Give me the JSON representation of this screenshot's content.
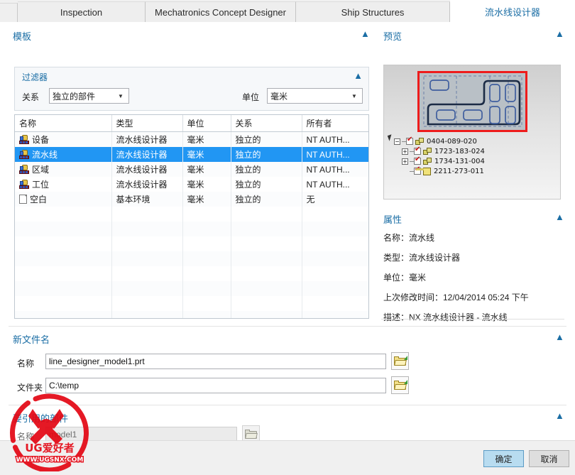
{
  "tabs": [
    {
      "label": "Inspection",
      "active": false
    },
    {
      "label": "Mechatronics Concept Designer",
      "active": false
    },
    {
      "label": "Ship Structures",
      "active": false
    },
    {
      "label": "流水线设计器",
      "active": true
    }
  ],
  "sections": {
    "template": {
      "title": "模板",
      "collapse_icon": "chevron-up-icon"
    },
    "preview": {
      "title": "预览",
      "collapse_icon": "chevron-up-icon"
    },
    "properties": {
      "title": "属性",
      "collapse_icon": "chevron-up-icon"
    },
    "new_file_name": {
      "title": "新文件名",
      "collapse_icon": "chevron-up-icon"
    },
    "reference_part": {
      "title": "要引用的部件",
      "collapse_icon": "chevron-up-icon"
    }
  },
  "filter": {
    "title": "过滤器",
    "collapse_icon": "chevron-up-icon",
    "relation_label": "关系",
    "relation_value": "独立的部件",
    "units_label": "单位",
    "units_value": "毫米",
    "dropdown_icon": "caret-down-icon"
  },
  "table": {
    "columns": [
      "名称",
      "类型",
      "单位",
      "关系",
      "所有者"
    ],
    "rows": [
      {
        "icon": "line-designer-icon",
        "name": "设备",
        "type": "流水线设计器",
        "units": "毫米",
        "relation": "独立的",
        "owner": "NT AUTH...",
        "selected": false
      },
      {
        "icon": "line-designer-icon",
        "name": "流水线",
        "type": "流水线设计器",
        "units": "毫米",
        "relation": "独立的",
        "owner": "NT AUTH...",
        "selected": true
      },
      {
        "icon": "line-designer-icon",
        "name": "区域",
        "type": "流水线设计器",
        "units": "毫米",
        "relation": "独立的",
        "owner": "NT AUTH...",
        "selected": false
      },
      {
        "icon": "line-designer-icon",
        "name": "工位",
        "type": "流水线设计器",
        "units": "毫米",
        "relation": "独立的",
        "owner": "NT AUTH...",
        "selected": false
      },
      {
        "icon": "blank-document-icon",
        "name": "空白",
        "type": "基本环境",
        "units": "毫米",
        "relation": "独立的",
        "owner": "无",
        "selected": false
      }
    ],
    "empty_row_count": 9
  },
  "preview_tree": [
    {
      "expander": "minus",
      "indent": 0,
      "checked": true,
      "icon": "assembly-icon",
      "label": "0404-089-020"
    },
    {
      "expander": "plus",
      "indent": 1,
      "checked": true,
      "icon": "assembly-icon",
      "label": "1723-183-024"
    },
    {
      "expander": "plus",
      "indent": 1,
      "checked": true,
      "icon": "assembly-icon",
      "label": "1734-131-004"
    },
    {
      "expander": "none",
      "indent": 1,
      "checked": true,
      "icon": "part-icon",
      "label": "2211-273-011"
    }
  ],
  "properties": [
    "名称：流水线",
    "类型：流水线设计器",
    "单位：毫米",
    "上次修改时间：12/04/2014 05:24 下午",
    "描述：NX 流水线设计器 - 流水线"
  ],
  "new_file": {
    "name_label": "名称",
    "name_value": "line_designer_model1.prt",
    "folder_label": "文件夹",
    "folder_value": "C:\\temp",
    "browse_icon": "open-folder-icon"
  },
  "reference_part": {
    "name_label": "名称",
    "name_value": "model1",
    "browse_icon": "open-folder-icon",
    "disabled": true
  },
  "buttons": {
    "ok": "确定",
    "cancel": "取消"
  },
  "watermark": {
    "brand": "UG爱好者",
    "url": "WWW.UGSNX.COM"
  },
  "colors": {
    "accent": "#1b6ea5",
    "selection": "#2196f3",
    "preview_border": "#ee1c1c",
    "watermark": "#e30613",
    "primary_button": "#b8dcf0"
  }
}
